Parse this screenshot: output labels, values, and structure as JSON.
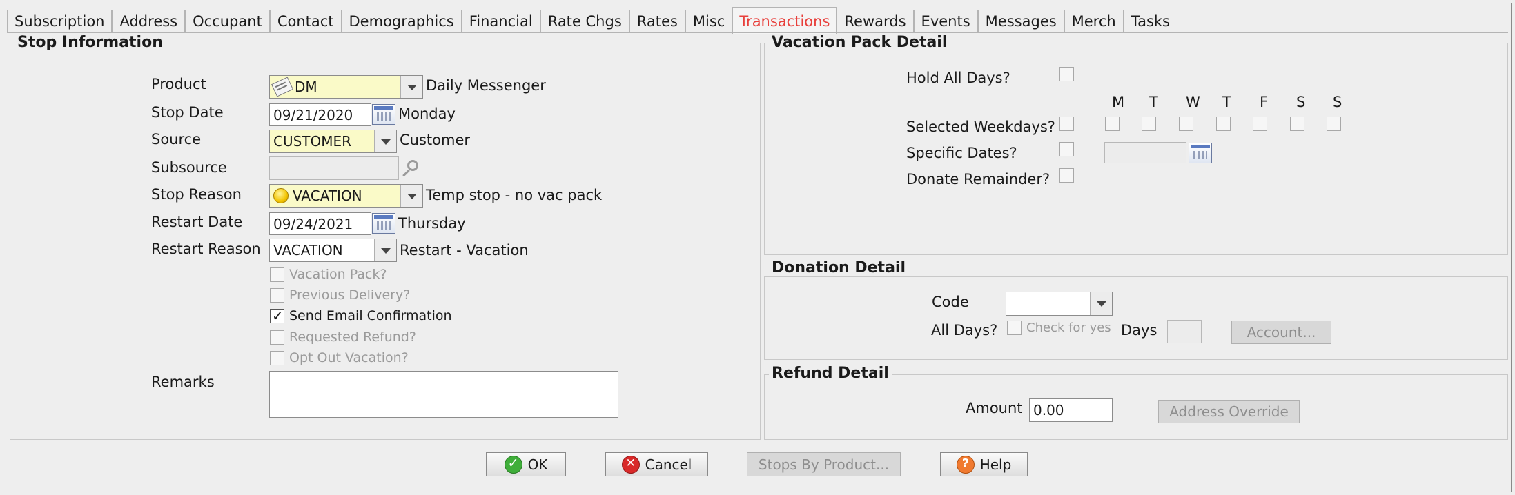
{
  "tabs": [
    "Subscription",
    "Address",
    "Occupant",
    "Contact",
    "Demographics",
    "Financial",
    "Rate Chgs",
    "Rates",
    "Misc",
    "Transactions",
    "Rewards",
    "Events",
    "Messages",
    "Merch",
    "Tasks"
  ],
  "active_tab": "Transactions",
  "stop_info": {
    "title": "Stop Information",
    "product_label": "Product",
    "product_value": "DM",
    "product_desc": "Daily Messenger",
    "stop_date_label": "Stop Date",
    "stop_date_value": "09/21/2020",
    "stop_date_desc": "Monday",
    "source_label": "Source",
    "source_value": "CUSTOMER",
    "source_desc": "Customer",
    "subsource_label": "Subsource",
    "subsource_value": "",
    "stop_reason_label": "Stop Reason",
    "stop_reason_value": "VACATION",
    "stop_reason_desc": "Temp stop - no vac pack",
    "restart_date_label": "Restart Date",
    "restart_date_value": "09/24/2021",
    "restart_date_desc": "Thursday",
    "restart_reason_label": "Restart Reason",
    "restart_reason_value": "VACATION",
    "restart_reason_desc": "Restart - Vacation",
    "vacation_pack": "Vacation Pack?",
    "previous_delivery": "Previous Delivery?",
    "send_email": "Send Email Confirmation",
    "requested_refund": "Requested Refund?",
    "opt_out": "Opt Out Vacation?",
    "remarks_label": "Remarks",
    "remarks_value": ""
  },
  "vacation_pack": {
    "title": "Vacation Pack Detail",
    "hold_all_days": "Hold All Days?",
    "weekday_headers": [
      "M",
      "T",
      "W",
      "T",
      "F",
      "S",
      "S"
    ],
    "selected_weekdays": "Selected Weekdays?",
    "specific_dates": "Specific Dates?",
    "specific_date_value": "",
    "donate_remainder": "Donate Remainder?"
  },
  "donation": {
    "title": "Donation Detail",
    "code_label": "Code",
    "code_value": "",
    "all_days_label": "All Days?",
    "check_for_yes": "Check for yes",
    "days_label": "Days",
    "days_value": "",
    "account_button": "Account..."
  },
  "refund": {
    "title": "Refund Detail",
    "amount_label": "Amount",
    "amount_value": "0.00",
    "address_override_button": "Address Override"
  },
  "buttons": {
    "ok": "OK",
    "cancel": "Cancel",
    "stops_by_product": "Stops By Product...",
    "help": "Help"
  }
}
